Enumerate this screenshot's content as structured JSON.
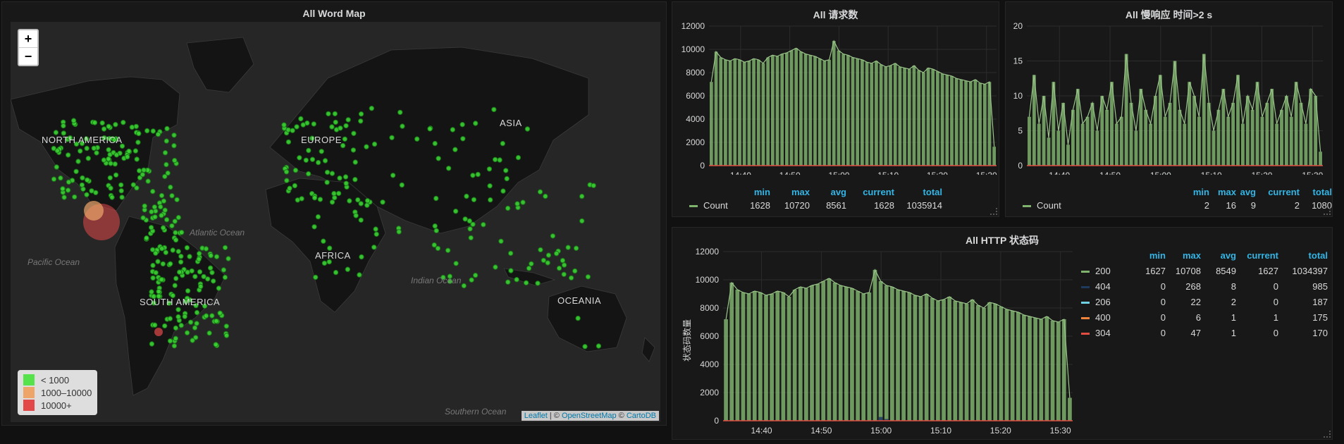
{
  "map_panel": {
    "title": "All Word Map",
    "zoom_in": "+",
    "zoom_out": "−",
    "continents": [
      "NORTH AMERICA",
      "EUROPE",
      "ASIA",
      "AFRICA",
      "SOUTH AMERICA",
      "OCEANIA"
    ],
    "oceans": [
      "Atlantic Ocean",
      "Pacific Ocean",
      "Indian Ocean",
      "Southern Ocean"
    ],
    "legend": [
      {
        "label": "< 1000",
        "color": "#56e24a"
      },
      {
        "label": "1000–10000",
        "color": "#eda56a"
      },
      {
        "label": "10000+",
        "color": "#e34848"
      }
    ],
    "attribution": {
      "leaflet": "Leaflet",
      "sep1": " | © ",
      "osm": "OpenStreetMap",
      "sep2": " © ",
      "carto": "CartoDB"
    }
  },
  "requests_panel": {
    "title": "All 请求数",
    "legend_headers": [
      "min",
      "max",
      "avg",
      "current",
      "total"
    ],
    "legend_series": {
      "name": "Count",
      "values": [
        "1628",
        "10720",
        "8561",
        "1628",
        "1035914"
      ],
      "color": "#7eb26d"
    }
  },
  "slow_panel": {
    "title": "All 慢响应 时间>2 s",
    "legend_headers": [
      "min",
      "max",
      "avg",
      "current",
      "total"
    ],
    "legend_series": {
      "name": "Count",
      "values": [
        "2",
        "16",
        "9",
        "2",
        "1080"
      ],
      "color": "#7eb26d"
    }
  },
  "status_panel": {
    "title": "All HTTP 状态码",
    "ylabel": "状态码数量",
    "legend_headers": [
      "min",
      "max",
      "avg",
      "current",
      "total"
    ],
    "legend_series": [
      {
        "name": "200",
        "values": [
          "1627",
          "10708",
          "8549",
          "1627",
          "1034397"
        ],
        "color": "#7eb26d"
      },
      {
        "name": "404",
        "values": [
          "0",
          "268",
          "8",
          "0",
          "985"
        ],
        "color": "#1f3a5f"
      },
      {
        "name": "206",
        "values": [
          "0",
          "22",
          "2",
          "0",
          "187"
        ],
        "color": "#6ed0e0"
      },
      {
        "name": "400",
        "values": [
          "0",
          "6",
          "1",
          "1",
          "175"
        ],
        "color": "#ef843c"
      },
      {
        "name": "304",
        "values": [
          "0",
          "47",
          "1",
          "0",
          "170"
        ],
        "color": "#e24d42"
      }
    ]
  },
  "chart_data": [
    {
      "type": "bar",
      "title": "All 请求数",
      "x_ticks": [
        "14:40",
        "14:50",
        "15:00",
        "15:10",
        "15:20",
        "15:30"
      ],
      "y_ticks": [
        "0",
        "2000",
        "4000",
        "6000",
        "8000",
        "10000",
        "12000"
      ],
      "ylim": [
        0,
        12000
      ],
      "series": [
        {
          "name": "Count",
          "values": [
            7200,
            9800,
            9300,
            9100,
            9000,
            9200,
            9100,
            8900,
            9000,
            9200,
            9100,
            8800,
            9300,
            9500,
            9400,
            9600,
            9700,
            9900,
            10100,
            9800,
            9600,
            9500,
            9400,
            9200,
            9000,
            9100,
            10720,
            9900,
            9600,
            9500,
            9300,
            9200,
            9100,
            8900,
            8800,
            9000,
            8700,
            8500,
            8600,
            8800,
            8500,
            8400,
            8300,
            8600,
            8200,
            8000,
            8400,
            8300,
            8100,
            7900,
            7800,
            7700,
            7500,
            7400,
            7300,
            7200,
            7400,
            7100,
            7000,
            7200,
            1628
          ]
        }
      ],
      "grid": true
    },
    {
      "type": "bar",
      "title": "All 慢响应 时间>2 s",
      "x_ticks": [
        "14:40",
        "14:50",
        "15:00",
        "15:10",
        "15:20",
        "15:30"
      ],
      "y_ticks": [
        "0",
        "5",
        "10",
        "15",
        "20"
      ],
      "ylim": [
        0,
        20
      ],
      "series": [
        {
          "name": "Count",
          "values": [
            7,
            13,
            6,
            10,
            4,
            12,
            5,
            9,
            3,
            8,
            11,
            6,
            7,
            9,
            5,
            10,
            8,
            12,
            6,
            7,
            16,
            9,
            5,
            11,
            8,
            6,
            10,
            13,
            7,
            9,
            15,
            8,
            6,
            12,
            10,
            7,
            16,
            9,
            5,
            8,
            11,
            7,
            9,
            13,
            6,
            10,
            8,
            12,
            7,
            9,
            11,
            6,
            8,
            10,
            7,
            12,
            9,
            6,
            11,
            10,
            2
          ]
        }
      ],
      "grid": true
    },
    {
      "type": "bar",
      "title": "All HTTP 状态码",
      "ylabel": "状态码数量",
      "x_ticks": [
        "14:40",
        "14:50",
        "15:00",
        "15:10",
        "15:20",
        "15:30"
      ],
      "y_ticks": [
        "0",
        "2000",
        "4000",
        "6000",
        "8000",
        "10000",
        "12000"
      ],
      "ylim": [
        0,
        12000
      ],
      "series": [
        {
          "name": "200",
          "values": [
            7200,
            9800,
            9300,
            9100,
            9000,
            9200,
            9100,
            8900,
            9000,
            9200,
            9100,
            8800,
            9300,
            9500,
            9400,
            9600,
            9700,
            9900,
            10100,
            9800,
            9600,
            9500,
            9400,
            9200,
            9000,
            9100,
            10708,
            9900,
            9600,
            9500,
            9300,
            9200,
            9100,
            8900,
            8800,
            9000,
            8700,
            8500,
            8600,
            8800,
            8500,
            8400,
            8300,
            8600,
            8200,
            8000,
            8400,
            8300,
            8100,
            7900,
            7800,
            7700,
            7500,
            7400,
            7300,
            7200,
            7400,
            7100,
            7000,
            7200,
            1627
          ]
        },
        {
          "name": "404",
          "values": [
            0,
            0,
            0,
            0,
            0,
            0,
            0,
            0,
            0,
            0,
            0,
            0,
            0,
            0,
            0,
            0,
            0,
            0,
            0,
            0,
            0,
            0,
            0,
            0,
            0,
            0,
            0,
            268,
            120,
            0,
            0,
            0,
            0,
            0,
            0,
            0,
            0,
            0,
            0,
            0,
            0,
            0,
            0,
            0,
            0,
            0,
            0,
            0,
            0,
            0,
            0,
            0,
            0,
            0,
            0,
            0,
            0,
            0,
            0,
            0,
            0
          ]
        },
        {
          "name": "206",
          "values": []
        },
        {
          "name": "400",
          "values": []
        },
        {
          "name": "304",
          "values": []
        }
      ],
      "grid": true
    }
  ]
}
